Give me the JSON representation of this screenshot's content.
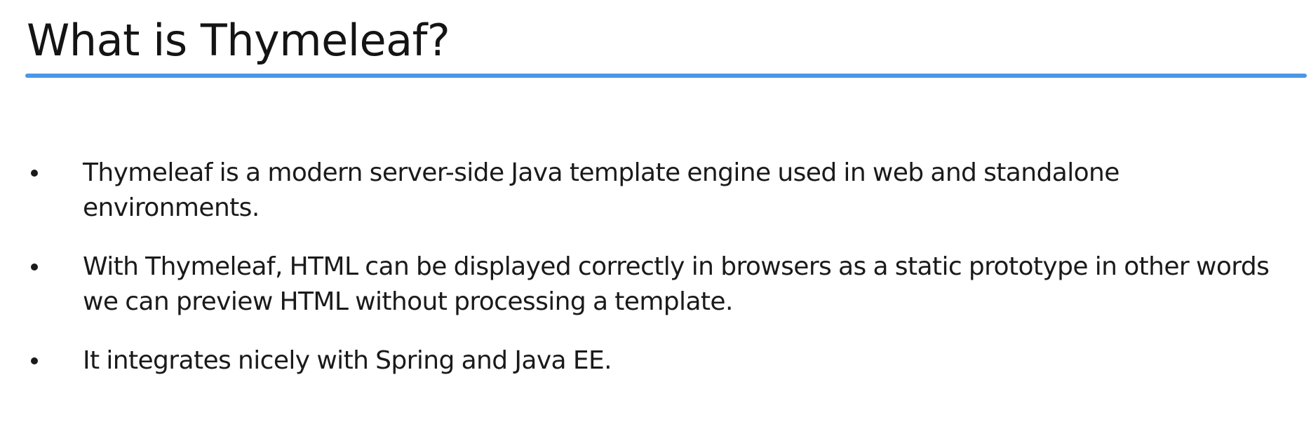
{
  "slide": {
    "title": "What is Thymeleaf?",
    "accent_color": "#4a97e6",
    "bullets": [
      {
        "text": "Thymeleaf is a modern server-side Java template engine used in web and standalone environments."
      },
      {
        "text": "With Thymeleaf, HTML can be displayed correctly in browsers as a static prototype in other words we can preview HTML without processing a template."
      },
      {
        "text": "It integrates nicely with Spring and Java EE."
      }
    ]
  }
}
